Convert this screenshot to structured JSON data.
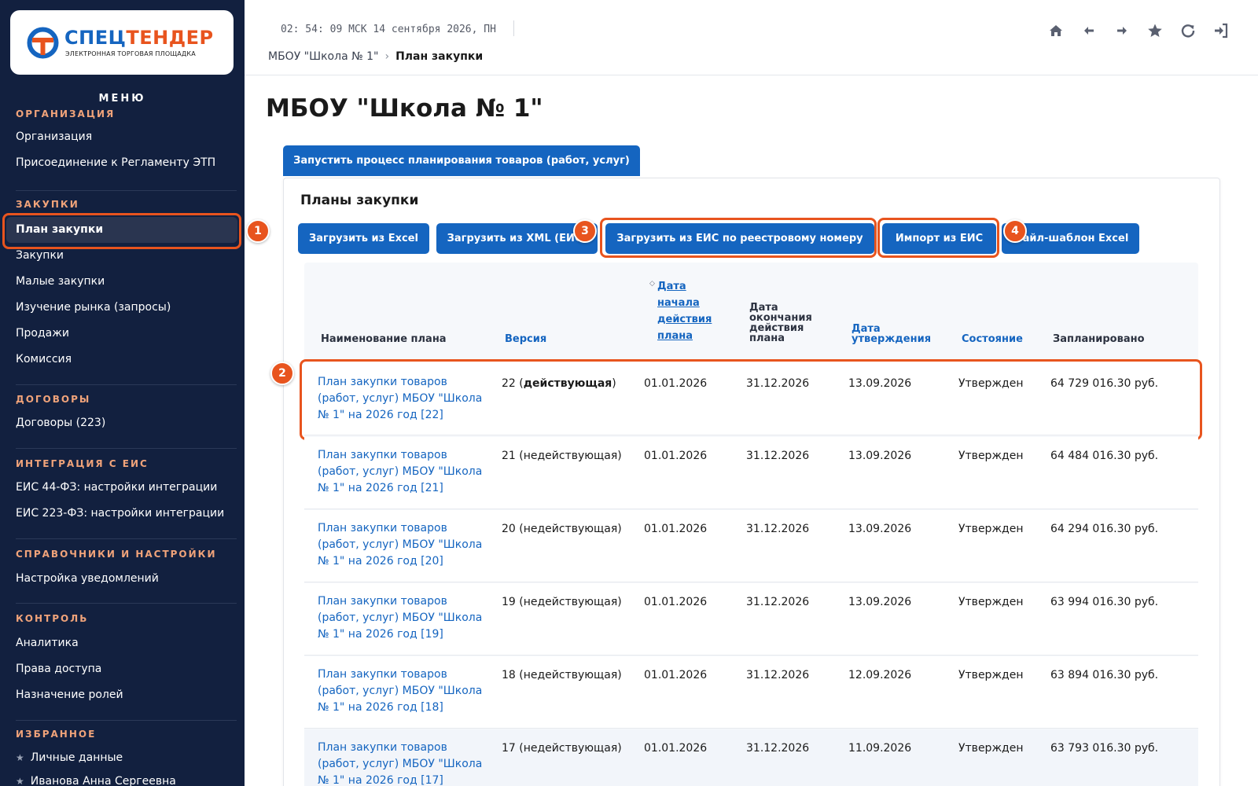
{
  "logo": {
    "title_part1": "СПЕЦ",
    "title_part2": "ТЕНДЕР",
    "subtitle": "ЭЛЕКТРОННАЯ ТОРГОВАЯ ПЛОЩАДКА",
    "colors": {
      "blue": "#1565c0",
      "orange": "#e8541e"
    }
  },
  "sidebar": {
    "menu_title": "МЕНЮ",
    "sections": [
      {
        "title": "ОРГАНИЗАЦИЯ",
        "items": [
          "Организация",
          "Присоединение к Регламенту ЭТП"
        ]
      },
      {
        "title": "ЗАКУПКИ",
        "items": [
          "План закупки",
          "Закупки",
          "Малые закупки",
          "Изучение рынка (запросы)",
          "Продажи",
          "Комиссия"
        ]
      },
      {
        "title": "ДОГОВОРЫ",
        "items": [
          "Договоры (223)"
        ]
      },
      {
        "title": "ИНТЕГРАЦИЯ С ЕИС",
        "items": [
          "ЕИС 44-ФЗ: настройки интеграции",
          "ЕИС 223-ФЗ: настройки интеграции"
        ]
      },
      {
        "title": "СПРАВОЧНИКИ И НАСТРОЙКИ",
        "items": [
          "Настройка уведомлений"
        ]
      },
      {
        "title": "КОНТРОЛЬ",
        "items": [
          "Аналитика",
          "Права доступа",
          "Назначение ролей"
        ]
      },
      {
        "title": "ИЗБРАННОЕ",
        "items": [
          "Личные данные",
          "Иванова Анна Сергеевна"
        ]
      }
    ],
    "active_item": "План закупки",
    "star_glyph": "★"
  },
  "header": {
    "clock": "02: 54: 09 МСК  14 сентября 2026, ПН",
    "breadcrumb": {
      "parent": "МБОУ \"Школа № 1\"",
      "separator": "›",
      "current": "План закупки"
    },
    "icons": [
      "home-icon",
      "back-arrow-icon",
      "forward-arrow-icon",
      "star-icon",
      "refresh-icon",
      "logout-icon"
    ]
  },
  "main": {
    "page_title": "МБОУ \"Школа № 1\"",
    "start_button": "Запустить процесс планирования товаров (работ, услуг)",
    "panel_title": "Планы закупки",
    "actions": {
      "excel": "Загрузить из Excel",
      "xml": "Загрузить из XML (ЕИС)",
      "eis_reg": "Загрузить из ЕИС по реестровому номеру",
      "import": "Импорт из ЕИС",
      "template": "Файл-шаблон Excel"
    },
    "annotations": [
      "1",
      "2",
      "3",
      "4"
    ],
    "highlight_color": "#e8541e"
  },
  "table": {
    "headers": {
      "name": "Наименование плана",
      "version": "Версия",
      "start_l1": "Дата",
      "start_l2": "начала",
      "start_l3": "действия",
      "start_l4": "плана",
      "end_l1": "Дата",
      "end_l2": "окончания",
      "end_l3": "действия",
      "end_l4": "плана",
      "approve_l1": "Дата",
      "approve_l2": "утверждения",
      "status": "Состояние",
      "planned": "Запланировано"
    },
    "rows": [
      {
        "name": "План закупки товаров (работ, услуг) МБОУ \"Школа № 1\" на 2026 год [22]",
        "version_num": "22 (",
        "version_state": "действующая",
        "version_close": ")",
        "start": "01.01.2026",
        "end": "31.12.2026",
        "approved": "13.09.2026",
        "status": "Утвержден",
        "planned": "64 729 016.30 руб."
      },
      {
        "name": "План закупки товаров (работ, услуг) МБОУ \"Школа № 1\" на 2026 год [21]",
        "version": "21 (недействующая)",
        "start": "01.01.2026",
        "end": "31.12.2026",
        "approved": "13.09.2026",
        "status": "Утвержден",
        "planned": "64 484 016.30 руб."
      },
      {
        "name": "План закупки товаров (работ, услуг) МБОУ \"Школа № 1\" на 2026 год [20]",
        "version": "20 (недействующая)",
        "start": "01.01.2026",
        "end": "31.12.2026",
        "approved": "13.09.2026",
        "status": "Утвержден",
        "planned": "64 294 016.30 руб."
      },
      {
        "name": "План закупки товаров (работ, услуг) МБОУ \"Школа № 1\" на 2026 год [19]",
        "version": "19 (недействующая)",
        "start": "01.01.2026",
        "end": "31.12.2026",
        "approved": "13.09.2026",
        "status": "Утвержден",
        "planned": "63 994 016.30 руб."
      },
      {
        "name": "План закупки товаров (работ, услуг) МБОУ \"Школа № 1\" на 2026 год [18]",
        "version": "18 (недействующая)",
        "start": "01.01.2026",
        "end": "31.12.2026",
        "approved": "12.09.2026",
        "status": "Утвержден",
        "planned": "63 894 016.30 руб."
      },
      {
        "name": "План закупки товаров (работ, услуг) МБОУ \"Школа № 1\" на 2026 год [17]",
        "version": "17 (недействующая)",
        "start": "01.01.2026",
        "end": "31.12.2026",
        "approved": "11.09.2026",
        "status": "Утвержден",
        "planned": "63 793 016.30 руб."
      }
    ]
  }
}
